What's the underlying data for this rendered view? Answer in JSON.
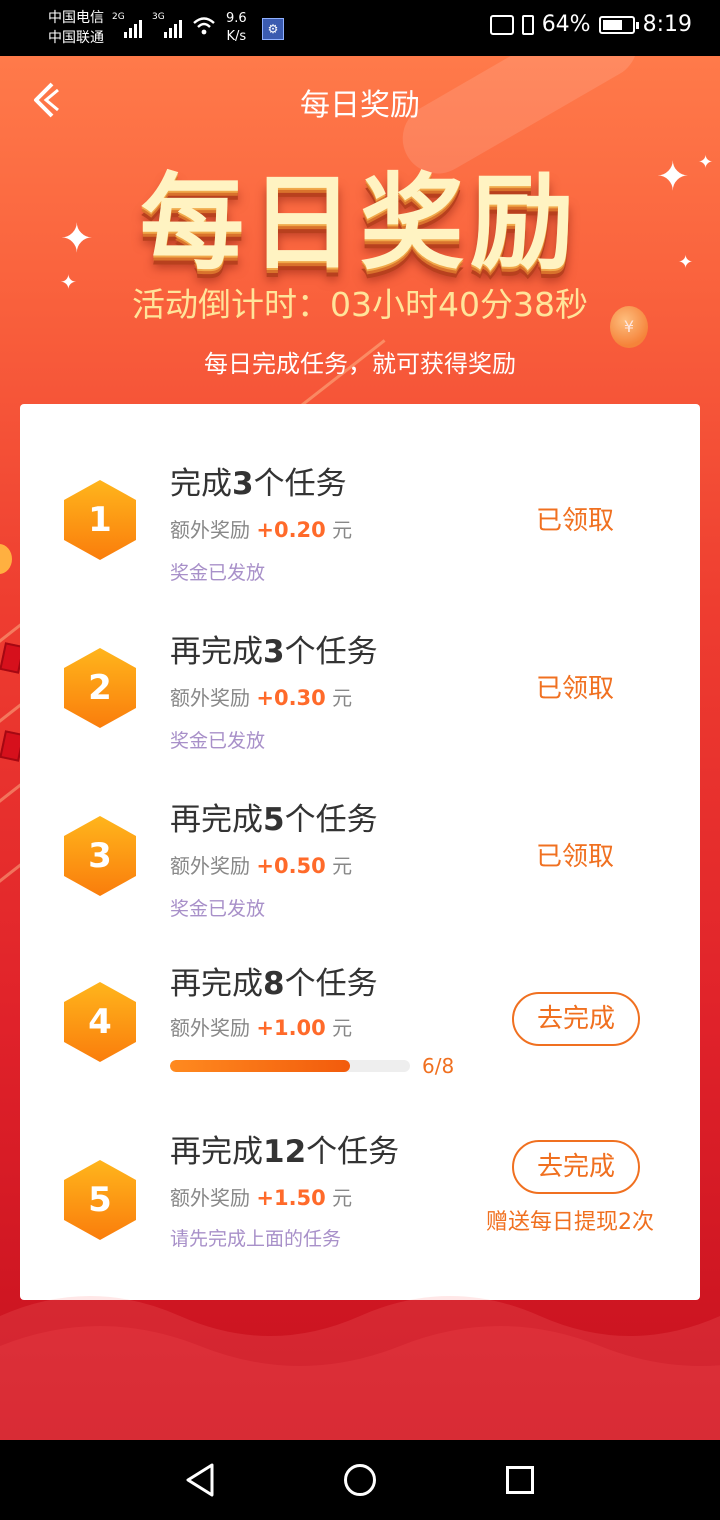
{
  "status_bar": {
    "carrier1": "中国电信",
    "carrier2": "中国联通",
    "net1": "2G",
    "net2": "3G",
    "speed_value": "9.6",
    "speed_unit": "K/s",
    "battery": "64%",
    "time": "8:19"
  },
  "header": {
    "title": "每日奖励"
  },
  "hero": {
    "title": "每日奖励",
    "countdown": "活动倒计时：03小时40分38秒",
    "subtitle": "每日完成任务，就可获得奖励"
  },
  "tasks": [
    {
      "number": "1",
      "title_prefix": "完成",
      "count": "3",
      "title_suffix": "个任务",
      "reward_label": "额外奖励",
      "reward_amount": "+0.20",
      "reward_unit": "元",
      "status": "奖金已发放",
      "action": "已领取"
    },
    {
      "number": "2",
      "title_prefix": "再完成",
      "count": "3",
      "title_suffix": "个任务",
      "reward_label": "额外奖励",
      "reward_amount": "+0.30",
      "reward_unit": "元",
      "status": "奖金已发放",
      "action": "已领取"
    },
    {
      "number": "3",
      "title_prefix": "再完成",
      "count": "5",
      "title_suffix": "个任务",
      "reward_label": "额外奖励",
      "reward_amount": "+0.50",
      "reward_unit": "元",
      "status": "奖金已发放",
      "action": "已领取"
    },
    {
      "number": "4",
      "title_prefix": "再完成",
      "count": "8",
      "title_suffix": "个任务",
      "reward_label": "额外奖励",
      "reward_amount": "+1.00",
      "reward_unit": "元",
      "progress_text": "6/8",
      "progress_fraction": 0.75,
      "action": "去完成"
    },
    {
      "number": "5",
      "title_prefix": "再完成",
      "count": "12",
      "title_suffix": "个任务",
      "reward_label": "额外奖励",
      "reward_amount": "+1.50",
      "reward_unit": "元",
      "status": "请先完成上面的任务",
      "action": "去完成",
      "bonus_note": "赠送每日提现2次"
    }
  ],
  "colors": {
    "accent": "#f07020",
    "reward_amount": "#ff6a2a",
    "status_text": "#a890c9",
    "hex_badge_top": "#ffb51c",
    "hex_badge_bottom": "#fa7d0c"
  },
  "icons": {
    "back": "back-arrow-icon",
    "sparkle": "sparkle-icon",
    "nav_back": "triangle-back-icon",
    "nav_home": "circle-home-icon",
    "nav_recent": "square-recent-icon"
  }
}
